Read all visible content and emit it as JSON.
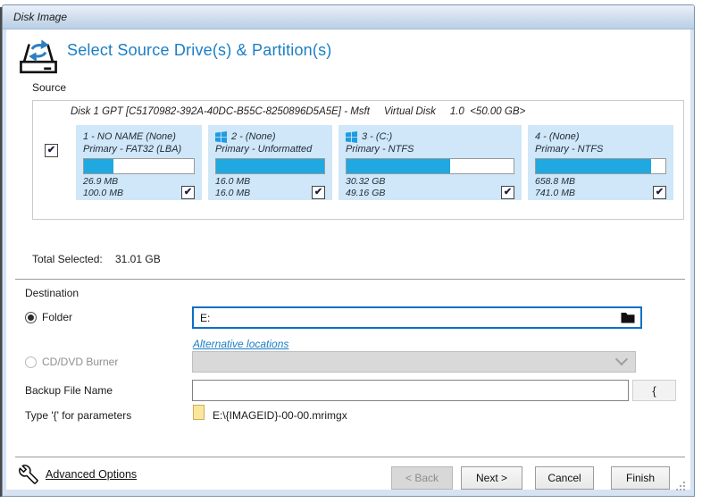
{
  "window": {
    "title": "Disk Image"
  },
  "header": {
    "title": "Select Source Drive(s) & Partition(s)"
  },
  "source": {
    "label": "Source",
    "disk_info": "Disk 1 GPT [C5170982-392A-40DC-B55C-8250896D5A5E] - Msft     Virtual Disk     1.0  <50.00 GB>",
    "disk_checked": true,
    "partitions": [
      {
        "name": "1 - NO NAME (None)",
        "type": "Primary - FAT32 (LBA)",
        "used": "26.9 MB",
        "total": "100.0 MB",
        "fill_percent": 27,
        "windows_logo": false,
        "checked": true
      },
      {
        "name": "2 -  (None)",
        "type": "Primary - Unformatted",
        "used": "16.0 MB",
        "total": "16.0 MB",
        "fill_percent": 100,
        "windows_logo": true,
        "checked": true
      },
      {
        "name": "3 -  (C:)",
        "type": "Primary - NTFS",
        "used": "30.32 GB",
        "total": "49.16 GB",
        "fill_percent": 62,
        "windows_logo": true,
        "checked": true
      },
      {
        "name": "4 -  (None)",
        "type": "Primary - NTFS",
        "used": "658.8 MB",
        "total": "741.0 MB",
        "fill_percent": 89,
        "windows_logo": false,
        "checked": true
      }
    ]
  },
  "summary": {
    "label": "Total Selected:",
    "value": "31.01 GB"
  },
  "destination": {
    "label": "Destination",
    "folder_radio_label": "Folder",
    "folder_radio_selected": true,
    "folder_value": "E:",
    "alternative_link": "Alternative locations",
    "cd_dvd_radio_label": "CD/DVD Burner",
    "cd_dvd_enabled": false,
    "backup_label": "Backup File Name",
    "backup_value": "",
    "brace_button": "{",
    "hint_label": "Type '{' for parameters",
    "file_path": "E:\\{IMAGEID}-00-00.mrimgx"
  },
  "footer": {
    "advanced_options": "Advanced Options",
    "back_label": "< Back",
    "next_label": "Next >",
    "cancel_label": "Cancel",
    "finish_label": "Finish"
  },
  "colors": {
    "accent_blue": "#1b7ec6",
    "partition_fill": "#20a8e0",
    "tile_background": "#cfe7f8",
    "folder_input_border": "#0d6fc6"
  }
}
